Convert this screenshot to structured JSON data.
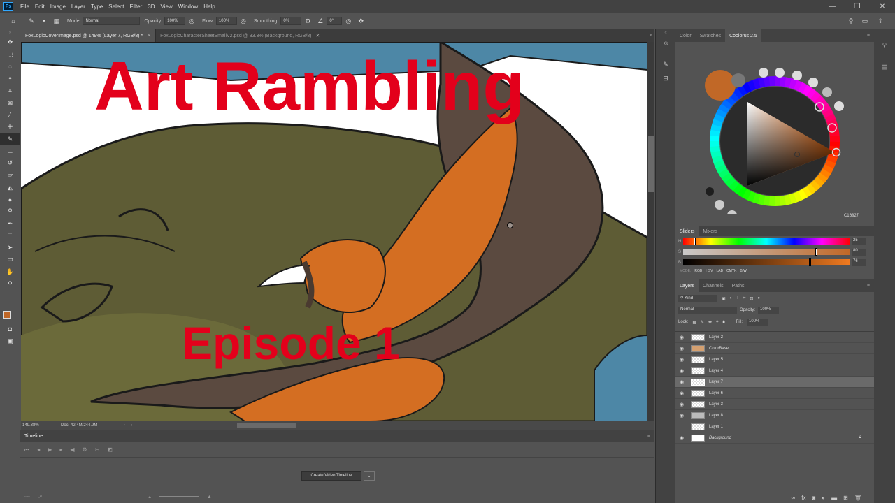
{
  "menu": [
    "File",
    "Edit",
    "Image",
    "Layer",
    "Type",
    "Select",
    "Filter",
    "3D",
    "View",
    "Window",
    "Help"
  ],
  "options": {
    "mode_label": "Mode:",
    "mode_value": "Normal",
    "opacity_label": "Opacity:",
    "opacity_value": "100%",
    "flow_label": "Flow:",
    "flow_value": "100%",
    "smoothing_label": "Smoothing:",
    "smoothing_value": "0%",
    "angle_value": "0°"
  },
  "tabs": [
    {
      "label": "FoxLogicCoverImage.psd @ 149% (Layer 7, RGB/8) *"
    },
    {
      "label": "FoxLogicCharacterSheetSmallV2.psd @ 33.3% (Background, RGB/8)"
    }
  ],
  "canvas": {
    "title": "Art Rambling",
    "subtitle": "Episode 1",
    "title_color": "#e3001b"
  },
  "status": {
    "zoom": "149.38%",
    "doc": "Doc: 42.4M/244.9M"
  },
  "timeline": {
    "tab": "Timeline",
    "create_button": "Create Video Timeline"
  },
  "color_panel": {
    "tabs": [
      "Color",
      "Swatches",
      "Coolorus 2.5"
    ],
    "hex": "C16827",
    "swatch_color": "#c16827"
  },
  "sliders": {
    "tabs": [
      "Sliders",
      "Mixers"
    ],
    "values": [
      "25",
      "80",
      "76"
    ],
    "modes_label": "MODE:",
    "modes": [
      "RGB",
      "HSV",
      "LAB",
      "CMYK",
      "B/W"
    ]
  },
  "layers": {
    "tabs": [
      "Layers",
      "Channels",
      "Paths"
    ],
    "kind": "Kind",
    "blend": "Normal",
    "opacity_label": "Opacity:",
    "opacity": "100%",
    "lock_label": "Lock:",
    "fill_label": "Fill:",
    "fill": "100%",
    "items": [
      {
        "name": "Layer 2"
      },
      {
        "name": "ColorBase"
      },
      {
        "name": "Layer 5"
      },
      {
        "name": "Layer 4"
      },
      {
        "name": "Layer 7",
        "selected": true
      },
      {
        "name": "Layer 6"
      },
      {
        "name": "Layer 3"
      },
      {
        "name": "Layer 8"
      },
      {
        "name": "Layer 1"
      },
      {
        "name": "Background",
        "italic": true
      }
    ]
  }
}
